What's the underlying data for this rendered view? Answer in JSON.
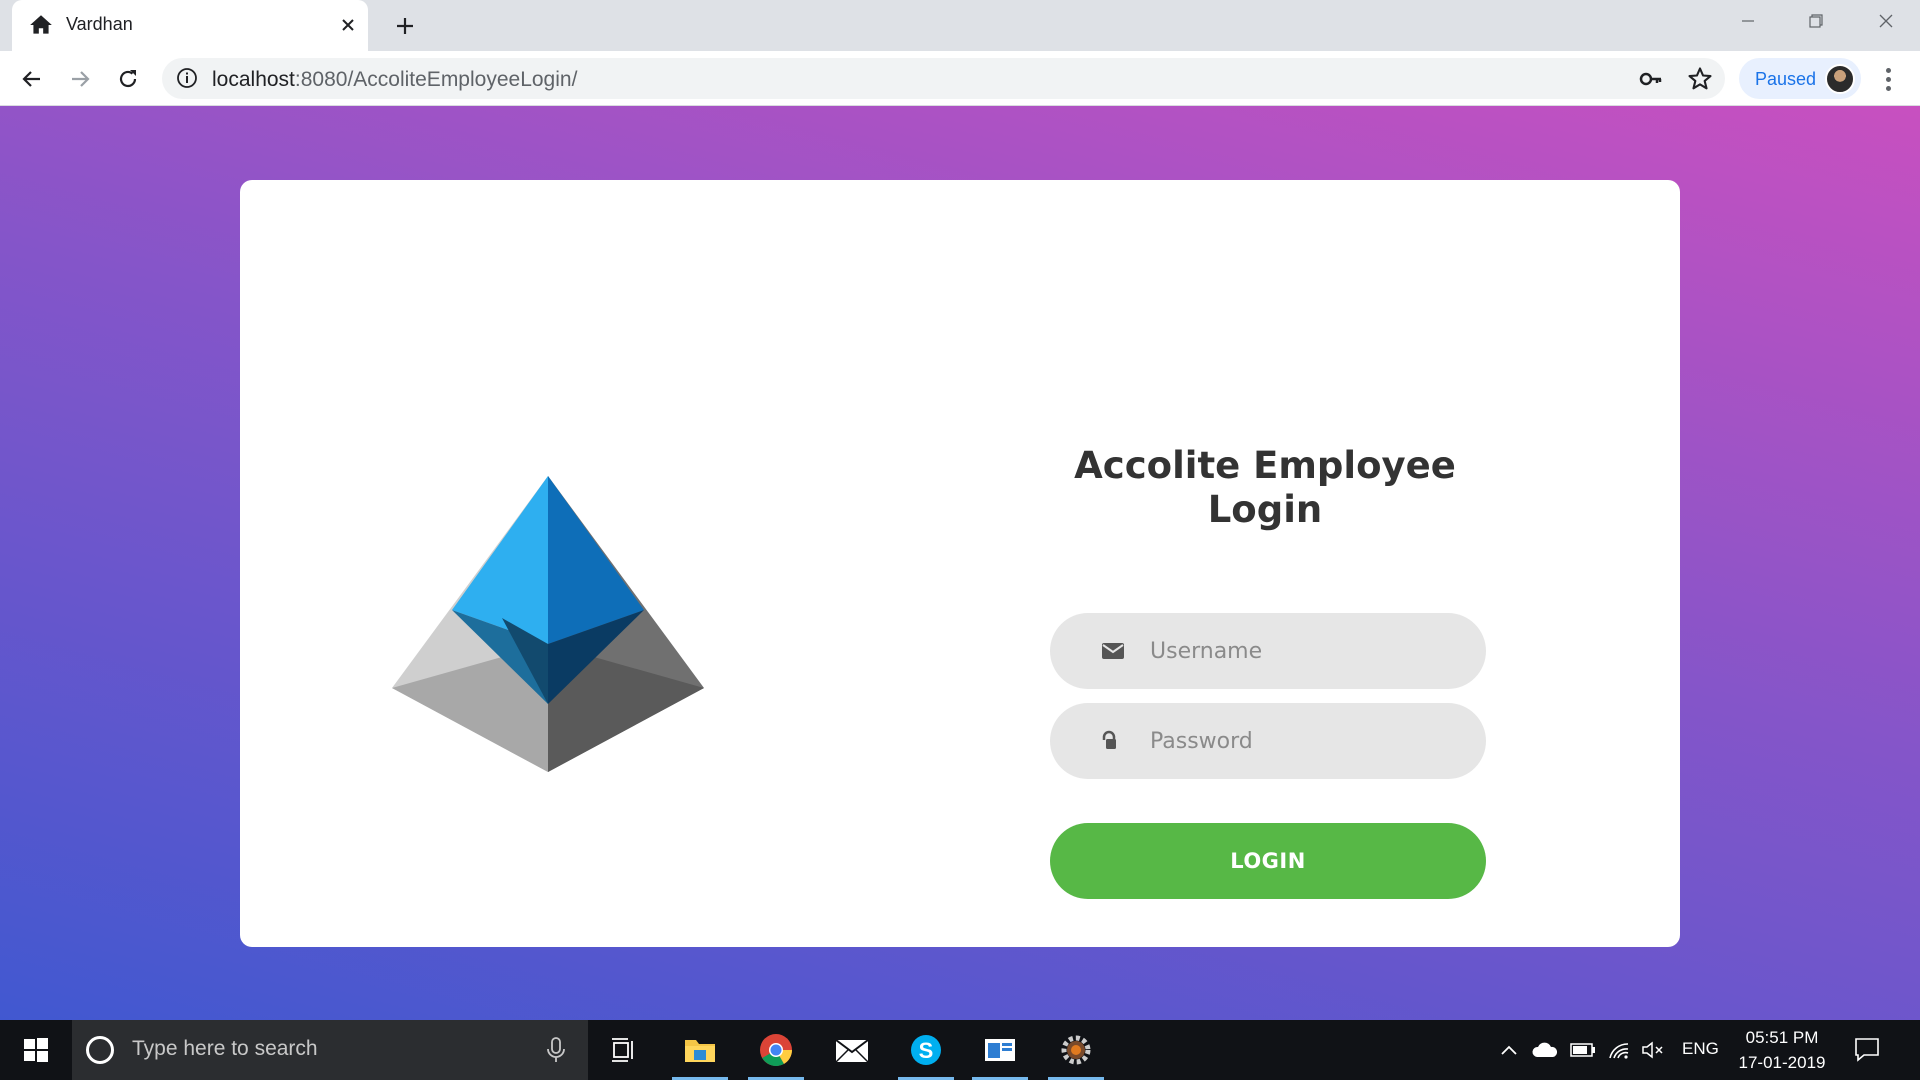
{
  "browser": {
    "tab_title": "Vardhan",
    "url_host": "localhost",
    "url_path": ":8080/AccoliteEmployeeLogin/",
    "profile_label": "Paused"
  },
  "login": {
    "title": "Accolite Employee Login",
    "username_placeholder": "Username",
    "password_placeholder": "Password",
    "button_label": "LOGIN"
  },
  "taskbar": {
    "search_placeholder": "Type here to search",
    "language": "ENG",
    "time": "05:51 PM",
    "date": "17-01-2019"
  },
  "colors": {
    "gradient_start": "#4158d0",
    "gradient_end": "#c850c0",
    "login_button": "#57b846",
    "input_bg": "#e6e6e6"
  },
  "icons": [
    "home-icon",
    "close-icon",
    "plus-icon",
    "back-icon",
    "forward-icon",
    "reload-icon",
    "info-icon",
    "key-icon",
    "star-icon",
    "envelope-icon",
    "lock-icon",
    "windows-icon",
    "cortana-icon",
    "mic-icon",
    "task-view-icon",
    "file-explorer-icon",
    "chrome-icon",
    "mail-icon",
    "skype-icon",
    "app-icon",
    "settings-gear-icon"
  ]
}
